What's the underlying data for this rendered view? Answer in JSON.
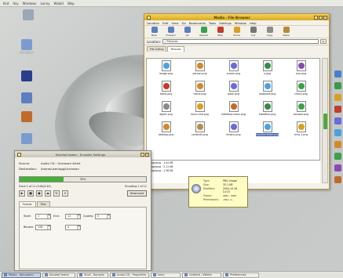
{
  "top_panel": {
    "items": [
      "Ksit",
      "Itsy",
      "Windows",
      "Lonny",
      "Wlokit",
      "Wep"
    ]
  },
  "desktop_icons": [
    {
      "label": "",
      "color": "#9aa7b7",
      "icon": "trash-icon"
    },
    {
      "label": "Computer",
      "color": "#7b9bd0",
      "icon": "computer-icon"
    },
    {
      "label": "",
      "color": "#2a3d8f",
      "icon": "anchor-icon"
    },
    {
      "label": "",
      "color": "#5d7ec0",
      "icon": "document-icon"
    },
    {
      "label": "",
      "color": "#c06a2a",
      "icon": "pencil-icon"
    },
    {
      "label": "",
      "color": "#7b9bd0",
      "icon": "folder-icon"
    }
  ],
  "file_manager": {
    "title": "Media - File Browser",
    "menu": [
      "Location",
      "Edit",
      "View",
      "Go",
      "Bookmarks",
      "Tools",
      "Settings",
      "Window",
      "Help"
    ],
    "toolbar": [
      {
        "label": "Back",
        "icon": "back-arrow-icon",
        "color": "#5a7fc0"
      },
      {
        "label": "Forward",
        "icon": "forward-arrow-icon",
        "color": "#5a7fc0"
      },
      {
        "label": "Up",
        "icon": "up-arrow-icon",
        "color": "#5a7fc0"
      },
      {
        "label": "Reload",
        "icon": "reload-icon",
        "color": "#3aa04a"
      },
      {
        "label": "Stop",
        "icon": "stop-icon",
        "color": "#c23b2b"
      },
      {
        "label": "Home",
        "icon": "home-icon",
        "color": "#d9a020"
      },
      {
        "label": "Cut",
        "icon": "cut-icon",
        "color": "#777777"
      },
      {
        "label": "Copy",
        "icon": "copy-icon",
        "color": "#8c8c8c"
      },
      {
        "label": "Paste",
        "icon": "paste-icon",
        "color": "#b58a3a"
      }
    ],
    "location": {
      "label": "Location:",
      "value": "/ Pictures"
    },
    "tabs": [
      "File Listing",
      "Pictures"
    ],
    "files": [
      {
        "name": "image.png",
        "color": "#4aa3df"
      },
      {
        "name": "person.png",
        "color": "#d08a2b"
      },
      {
        "name": "screen.png",
        "color": "#6a6ad8"
      },
      {
        "name": "x.png",
        "color": "#3a8a4a"
      },
      {
        "name": "icon.png",
        "color": "#8a4ab0"
      },
      {
        "name": "blank.png",
        "color": "#c23b2b"
      },
      {
        "name": "home.png",
        "color": "#d08a2b"
      },
      {
        "name": "book.png",
        "color": "#6a6ad8"
      },
      {
        "name": "clipboard.png",
        "color": "#4aa3df"
      },
      {
        "name": "check.png",
        "color": "#3aa04a"
      },
      {
        "name": "agent.png",
        "color": "#8a8a8a"
      },
      {
        "name": "kmix-cmd.png",
        "color": "#d9a020"
      },
      {
        "name": "kdesktop-icons.png",
        "color": "#c06a2a"
      },
      {
        "name": "kweather.png",
        "color": "#3a8a4a"
      },
      {
        "name": "konsole.png",
        "color": "#3aa04a"
      },
      {
        "name": "desktop.png",
        "color": "#d08a2b"
      },
      {
        "name": "contents.png",
        "color": "#b09050"
      },
      {
        "name": "kmenu.png",
        "color": "#6a6ad8"
      },
      {
        "name": "kaudiocreator.png",
        "color": "#4aa3df",
        "selected": true
      },
      {
        "name": "kmix-1.png",
        "color": "#d9a020"
      }
    ],
    "lower_lines": [
      "image/png · 1.04 KB",
      "image/png · 2.11 KB",
      "image/png · 1.36 KB"
    ]
  },
  "tooltip": {
    "rows": [
      {
        "k": "Type:",
        "v": "PNG image"
      },
      {
        "k": "Size:",
        "v": "35.1 KB"
      },
      {
        "k": "Modified:",
        "v": "2004-10-26 14:15"
      },
      {
        "k": "Owner:",
        "v": "user - user"
      },
      {
        "k": "Permissions:",
        "v": "-rw-r--r--"
      }
    ]
  },
  "audio_tool": {
    "title": "KAudioCreator - Encoder Settings",
    "info": [
      {
        "k": "Source:",
        "v": "Audio CD - Unknown Artist"
      },
      {
        "k": "Destination:",
        "v": "/home/user/ogg/Unknown"
      }
    ],
    "progress": {
      "value": 0.35,
      "label": "35%"
    },
    "status_left": "Track 1 of 11 (0:00/3:44)",
    "status_right": "Encoding 1 of 11",
    "tabs": [
      "Format",
      "Files"
    ],
    "spin_rows": [
      [
        {
          "k": "Start:",
          "v": "1"
        },
        {
          "k": "End:",
          "v": "11"
        },
        {
          "k": "Quality:",
          "v": "5"
        }
      ],
      [
        {
          "k": "Bitrate:",
          "v": "128"
        },
        {
          "k": "",
          "v": "4"
        }
      ]
    ],
    "download_btn": "Download"
  },
  "taskbar": [
    {
      "label": "Media - Konqueror",
      "active": true
    },
    {
      "label": "KAudioCreator",
      "active": false
    },
    {
      "label": "Shell - Konsole",
      "active": false
    },
    {
      "label": "Audio CD - Properties",
      "active": false
    },
    {
      "label": "kmix",
      "active": false
    },
    {
      "label": "Untitled - KWrite",
      "active": false
    },
    {
      "label": "Preferences",
      "active": false
    }
  ],
  "right_strip": [
    "#4a7fc7",
    "#3a9a4a",
    "#d9a020",
    "#c23b2b",
    "#6a6ad8",
    "#4aa3df",
    "#d08a2b",
    "#3aa04a",
    "#8a4ab0",
    "#c06a2a"
  ]
}
